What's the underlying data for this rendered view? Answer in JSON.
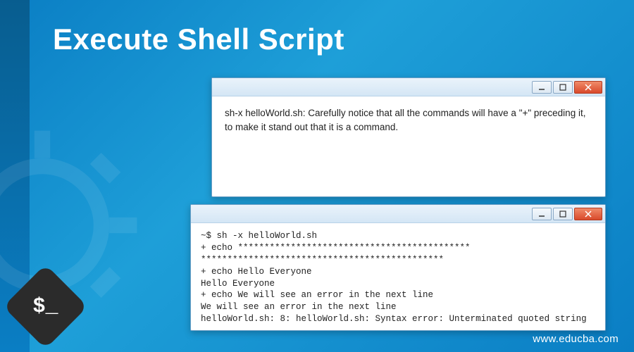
{
  "page": {
    "title": "Execute Shell Script"
  },
  "back_window": {
    "body_text": "sh-x helloWorld.sh: Carefully notice that all the commands will have a \"+\" preceding it, to make it stand out that it is a command."
  },
  "front_window": {
    "terminal_lines": [
      "~$ sh -x helloWorld.sh",
      "+ echo ********************************************",
      "**********************************************",
      "+ echo Hello Everyone",
      "Hello Everyone",
      "+ echo We will see an error in the next line",
      "We will see an error in the next line",
      "helloWorld.sh: 8: helloWorld.sh: Syntax error: Unterminated quoted string"
    ]
  },
  "bash_icon": {
    "glyph": "$_"
  },
  "footer": {
    "url": "www.educba.com"
  },
  "window_controls": {
    "minimize": "minimize",
    "maximize": "maximize",
    "close": "close"
  }
}
